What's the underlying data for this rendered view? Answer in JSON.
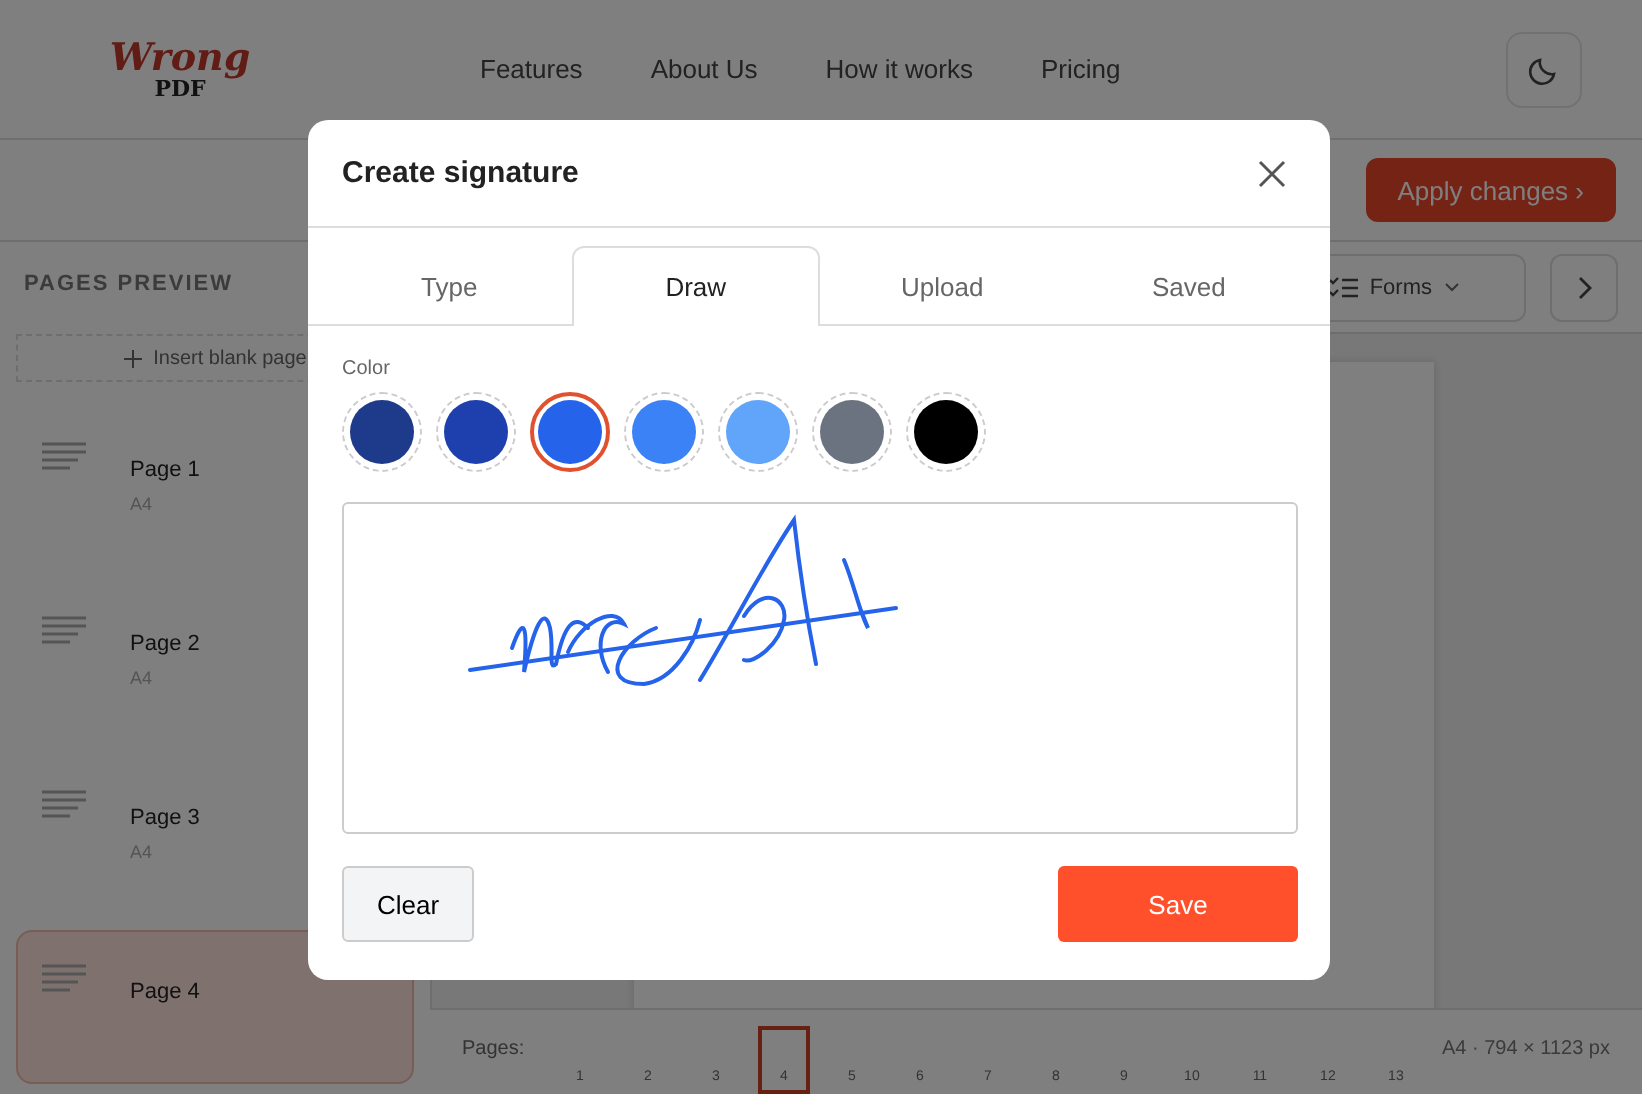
{
  "header": {
    "logo_top": "Wrong",
    "logo_bottom": "PDF",
    "nav": [
      "Features",
      "About Us",
      "How it works",
      "Pricing"
    ]
  },
  "toolbar": {
    "apply_button": "Apply changes ›",
    "forms_button": "Forms"
  },
  "sidebar": {
    "title": "PAGES PREVIEW",
    "insert_button": "Insert blank page",
    "pages": [
      {
        "name": "Page 1",
        "size": "A4",
        "selected": false
      },
      {
        "name": "Page 2",
        "size": "A4",
        "selected": false
      },
      {
        "name": "Page 3",
        "size": "A4",
        "selected": false
      },
      {
        "name": "Page 4",
        "selected": true
      }
    ]
  },
  "pager": {
    "label": "Pages:",
    "pages": [
      {
        "label": "1",
        "selected": false
      },
      {
        "label": "2",
        "selected": false
      },
      {
        "label": "3",
        "selected": false
      },
      {
        "label": "4",
        "selected": true
      },
      {
        "label": "5",
        "selected": false
      },
      {
        "label": "6",
        "selected": false
      },
      {
        "label": "7",
        "selected": false
      },
      {
        "label": "8",
        "selected": false
      },
      {
        "label": "9",
        "selected": false
      },
      {
        "label": "10",
        "selected": false
      },
      {
        "label": "11",
        "selected": false
      },
      {
        "label": "12",
        "selected": false
      },
      {
        "label": "13",
        "selected": false
      }
    ],
    "info": "A4 · 794 × 1123 px"
  },
  "dialog": {
    "title": "Create signature",
    "tabs": [
      {
        "label": "Type",
        "selected": false
      },
      {
        "label": "Draw",
        "selected": true
      },
      {
        "label": "Upload",
        "selected": false
      },
      {
        "label": "Saved",
        "selected": false
      }
    ],
    "color_label": "Color",
    "colors": [
      {
        "color": "#1e3a8a",
        "selected": false
      },
      {
        "color": "#1e40af",
        "selected": false
      },
      {
        "color": "#2563eb",
        "selected": true
      },
      {
        "color": "#3b82f6",
        "selected": false
      },
      {
        "color": "#60a5fa",
        "selected": false
      },
      {
        "color": "#6b7280",
        "selected": false
      },
      {
        "color": "#000000",
        "selected": false
      }
    ],
    "clear_button": "Clear",
    "save_button": "Save"
  }
}
